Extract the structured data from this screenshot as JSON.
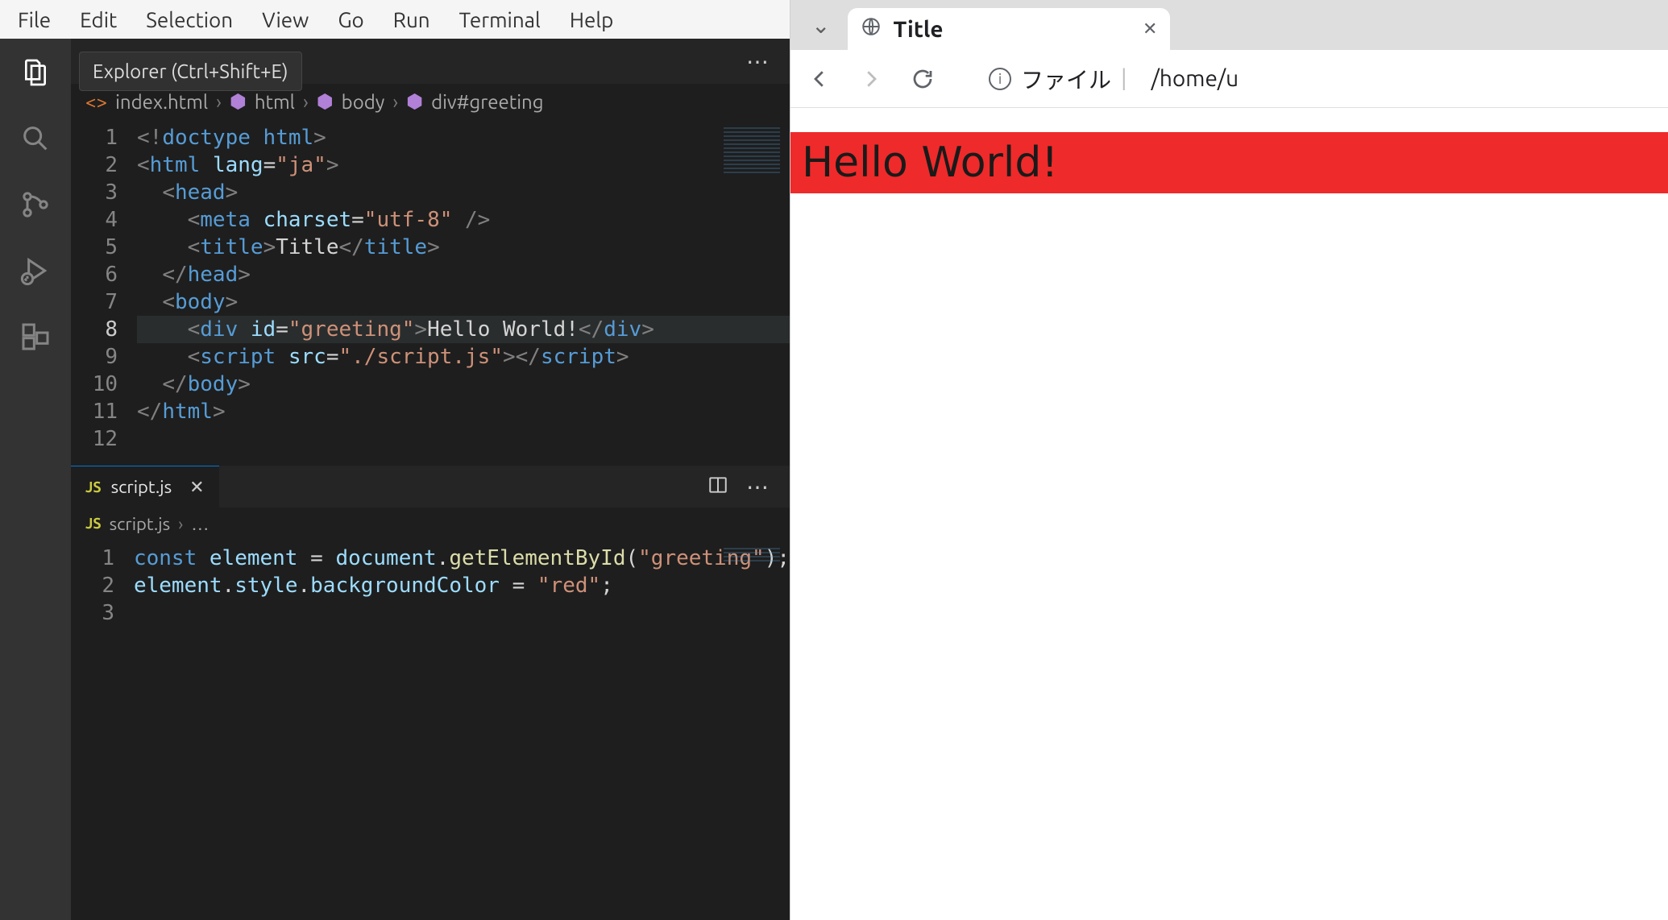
{
  "menubar": [
    "File",
    "Edit",
    "Selection",
    "View",
    "Go",
    "Run",
    "Terminal",
    "Help"
  ],
  "tooltip": "Explorer (Ctrl+Shift+E)",
  "breadcrumbs": {
    "file": "index.html",
    "path": [
      "html",
      "body",
      "div#greeting"
    ]
  },
  "editor1_lines": [
    {
      "n": 1,
      "seg": [
        [
          "gray",
          "<!"
        ],
        [
          "blue",
          "doctype "
        ],
        [
          "blue",
          "html"
        ],
        [
          "gray",
          ">"
        ]
      ]
    },
    {
      "n": 2,
      "seg": [
        [
          "gray",
          "<"
        ],
        [
          "blue",
          "html "
        ],
        [
          "lblue",
          "lang"
        ],
        [
          "white",
          "="
        ],
        [
          "str",
          "\"ja\""
        ],
        [
          "gray",
          ">"
        ]
      ]
    },
    {
      "n": 3,
      "seg": [
        [
          "white",
          "  "
        ],
        [
          "gray",
          "<"
        ],
        [
          "blue",
          "head"
        ],
        [
          "gray",
          ">"
        ]
      ]
    },
    {
      "n": 4,
      "seg": [
        [
          "white",
          "    "
        ],
        [
          "gray",
          "<"
        ],
        [
          "blue",
          "meta "
        ],
        [
          "lblue",
          "charset"
        ],
        [
          "white",
          "="
        ],
        [
          "str",
          "\"utf-8\""
        ],
        [
          "gray",
          " />"
        ]
      ]
    },
    {
      "n": 5,
      "seg": [
        [
          "white",
          "    "
        ],
        [
          "gray",
          "<"
        ],
        [
          "blue",
          "title"
        ],
        [
          "gray",
          ">"
        ],
        [
          "white",
          "Title"
        ],
        [
          "gray",
          "</"
        ],
        [
          "blue",
          "title"
        ],
        [
          "gray",
          ">"
        ]
      ]
    },
    {
      "n": 6,
      "seg": [
        [
          "white",
          "  "
        ],
        [
          "gray",
          "</"
        ],
        [
          "blue",
          "head"
        ],
        [
          "gray",
          ">"
        ]
      ]
    },
    {
      "n": 7,
      "seg": [
        [
          "white",
          "  "
        ],
        [
          "gray",
          "<"
        ],
        [
          "blue",
          "body"
        ],
        [
          "gray",
          ">"
        ]
      ]
    },
    {
      "n": 8,
      "cur": true,
      "seg": [
        [
          "white",
          "    "
        ],
        [
          "gray",
          "<"
        ],
        [
          "blue",
          "div "
        ],
        [
          "lblue",
          "id"
        ],
        [
          "white",
          "="
        ],
        [
          "str",
          "\"greeting\""
        ],
        [
          "gray",
          ">"
        ],
        [
          "white",
          "Hello World!"
        ],
        [
          "gray",
          "</"
        ],
        [
          "blue",
          "div"
        ],
        [
          "gray",
          ">"
        ]
      ]
    },
    {
      "n": 9,
      "seg": [
        [
          "white",
          "    "
        ],
        [
          "gray",
          "<"
        ],
        [
          "blue",
          "script "
        ],
        [
          "lblue",
          "src"
        ],
        [
          "white",
          "="
        ],
        [
          "str",
          "\"./script.js\""
        ],
        [
          "gray",
          "></"
        ],
        [
          "blue",
          "script"
        ],
        [
          "gray",
          ">"
        ]
      ]
    },
    {
      "n": 10,
      "seg": [
        [
          "white",
          "  "
        ],
        [
          "gray",
          "</"
        ],
        [
          "blue",
          "body"
        ],
        [
          "gray",
          ">"
        ]
      ]
    },
    {
      "n": 11,
      "seg": [
        [
          "gray",
          "</"
        ],
        [
          "blue",
          "html"
        ],
        [
          "gray",
          ">"
        ]
      ]
    },
    {
      "n": 12,
      "seg": []
    }
  ],
  "lower_tab": "script.js",
  "lower_crumb": "script.js",
  "lower_crumb_tail": "…",
  "editor2_lines": [
    {
      "n": 1,
      "seg": [
        [
          "kw",
          "const "
        ],
        [
          "lblue",
          "element"
        ],
        [
          "white",
          " = "
        ],
        [
          "lblue",
          "document"
        ],
        [
          "white",
          "."
        ],
        [
          "fn",
          "getElementById"
        ],
        [
          "white",
          "("
        ],
        [
          "str",
          "\"greeting\""
        ],
        [
          "white",
          ");"
        ]
      ]
    },
    {
      "n": 2,
      "seg": [
        [
          "lblue",
          "element"
        ],
        [
          "white",
          "."
        ],
        [
          "lblue",
          "style"
        ],
        [
          "white",
          "."
        ],
        [
          "lblue",
          "backgroundColor"
        ],
        [
          "white",
          " = "
        ],
        [
          "str",
          "\"red\""
        ],
        [
          "white",
          ";"
        ]
      ]
    },
    {
      "n": 3,
      "seg": []
    }
  ],
  "browser": {
    "tab_title": "Title",
    "addr_label": "ファイル",
    "url": "/home/u",
    "hello": "Hello World!"
  }
}
